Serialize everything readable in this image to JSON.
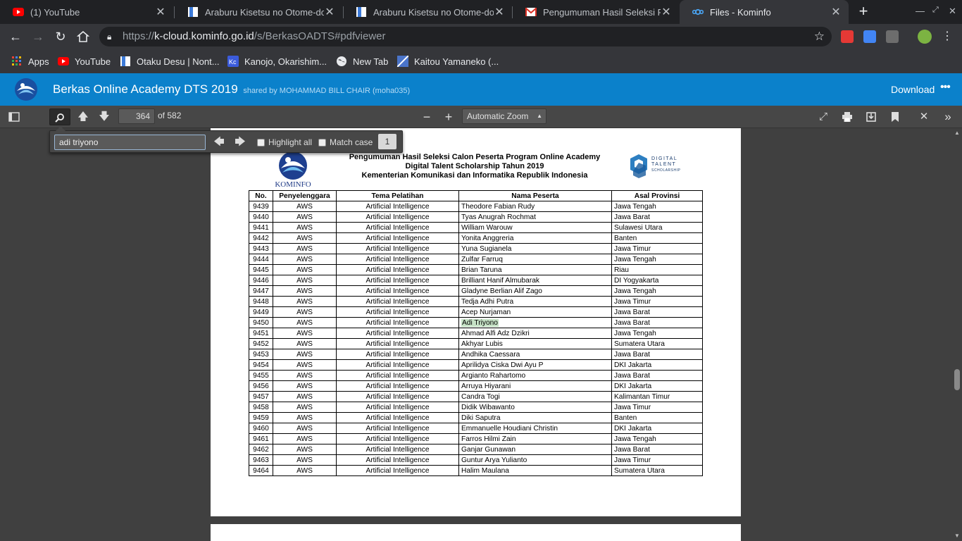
{
  "browser": {
    "tabs": [
      {
        "title": "(1) YouTube",
        "favicon": "youtube-icon",
        "active": false
      },
      {
        "title": "Araburu Kisetsu no Otome-dom",
        "favicon": "bookmark-doc-icon",
        "active": false
      },
      {
        "title": "Araburu Kisetsu no Otome-dom",
        "favicon": "bookmark-doc-icon",
        "active": false
      },
      {
        "title": "Pengumuman Hasil Seleksi Pro",
        "favicon": "gmail-icon",
        "active": false
      },
      {
        "title": "Files - Kominfo",
        "favicon": "nextcloud-icon",
        "active": true
      }
    ],
    "url": {
      "scheme": "https://",
      "host": "k-cloud.kominfo.go.id",
      "path": "/s/BerkasOADTS#pdfviewer"
    },
    "bookmarks": [
      {
        "label": "Apps",
        "icon": "apps-grid-icon"
      },
      {
        "label": "YouTube",
        "icon": "youtube-icon"
      },
      {
        "label": "Otaku Desu | Nont...",
        "icon": "bookmark-doc-icon"
      },
      {
        "label": "Kanojo, Okarishim...",
        "icon": "kc-icon"
      },
      {
        "label": "New Tab",
        "icon": "globe-icon"
      },
      {
        "label": "Kaitou Yamaneko (...",
        "icon": "bookmark-stripe-icon"
      }
    ]
  },
  "app": {
    "title": "Berkas Online Academy DTS 2019",
    "shared_by": "shared by MOHAMMAD BILL CHAIR (moha035)",
    "download_label": "Download",
    "brand_color": "#0b81cb"
  },
  "pdf_toolbar": {
    "page_number": "364",
    "page_of": "of 582",
    "zoom": "Automatic Zoom"
  },
  "findbar": {
    "query": "adi triyono",
    "highlight_all_label": "Highlight all",
    "match_case_label": "Match case",
    "match_count": "1"
  },
  "document": {
    "logo_text": "KOMINFO",
    "dts_logo_text": [
      "DIGITAL",
      "TALENT",
      "SCHOLARSHIP"
    ],
    "title_lines": [
      "Pengumuman Hasil Seleksi Calon Peserta Program Online Academy",
      "Digital Talent Scholarship Tahun 2019",
      "Kementerian Komunikasi dan Informatika Republik Indonesia"
    ],
    "columns": [
      "No.",
      "Penyelenggara",
      "Tema Pelatihan",
      "Nama Peserta",
      "Asal Provinsi"
    ],
    "highlight_name": "Adi Triyono",
    "rows": [
      [
        "9439",
        "AWS",
        "Artificial Intelligence",
        "Theodore Fabian Rudy",
        "Jawa Tengah"
      ],
      [
        "9440",
        "AWS",
        "Artificial Intelligence",
        "Tyas Anugrah Rochmat",
        "Jawa Barat"
      ],
      [
        "9441",
        "AWS",
        "Artificial Intelligence",
        "William Warouw",
        "Sulawesi Utara"
      ],
      [
        "9442",
        "AWS",
        "Artificial Intelligence",
        "Yonita Anggreria",
        "Banten"
      ],
      [
        "9443",
        "AWS",
        "Artificial Intelligence",
        "Yuna Sugianela",
        "Jawa Timur"
      ],
      [
        "9444",
        "AWS",
        "Artificial Intelligence",
        "Zulfar Farruq",
        "Jawa Tengah"
      ],
      [
        "9445",
        "AWS",
        "Artificial Intelligence",
        "Brian Taruna",
        "Riau"
      ],
      [
        "9446",
        "AWS",
        "Artificial Intelligence",
        "Brilliant Hanif Almubarak",
        "DI Yogyakarta"
      ],
      [
        "9447",
        "AWS",
        "Artificial Intelligence",
        "Gladyne Berlian Alif Zago",
        "Jawa Tengah"
      ],
      [
        "9448",
        "AWS",
        "Artificial Intelligence",
        "Tedja Adhi Putra",
        "Jawa Timur"
      ],
      [
        "9449",
        "AWS",
        "Artificial Intelligence",
        "Acep Nurjaman",
        "Jawa Barat"
      ],
      [
        "9450",
        "AWS",
        "Artificial Intelligence",
        "Adi Triyono",
        "Jawa Barat"
      ],
      [
        "9451",
        "AWS",
        "Artificial Intelligence",
        "Ahmad Alfi Adz Dzikri",
        "Jawa Tengah"
      ],
      [
        "9452",
        "AWS",
        "Artificial Intelligence",
        "Akhyar Lubis",
        "Sumatera Utara"
      ],
      [
        "9453",
        "AWS",
        "Artificial Intelligence",
        "Andhika Caessara",
        "Jawa Barat"
      ],
      [
        "9454",
        "AWS",
        "Artificial Intelligence",
        "Aprilidya Ciska Dwi Ayu P",
        "DKI Jakarta"
      ],
      [
        "9455",
        "AWS",
        "Artificial Intelligence",
        "Argianto Rahartomo",
        "Jawa Barat"
      ],
      [
        "9456",
        "AWS",
        "Artificial Intelligence",
        "Arruya Hiyarani",
        "DKI Jakarta"
      ],
      [
        "9457",
        "AWS",
        "Artificial Intelligence",
        "Candra Togi",
        "Kalimantan Timur"
      ],
      [
        "9458",
        "AWS",
        "Artificial Intelligence",
        "Didik Wibawanto",
        "Jawa Timur"
      ],
      [
        "9459",
        "AWS",
        "Artificial Intelligence",
        "Diki Saputra",
        "Banten"
      ],
      [
        "9460",
        "AWS",
        "Artificial Intelligence",
        "Emmanuelle Houdiani Christin",
        "DKI Jakarta"
      ],
      [
        "9461",
        "AWS",
        "Artificial Intelligence",
        "Farros Hilmi Zain",
        "Jawa Tengah"
      ],
      [
        "9462",
        "AWS",
        "Artificial Intelligence",
        "Ganjar Gunawan",
        "Jawa Barat"
      ],
      [
        "9463",
        "AWS",
        "Artificial Intelligence",
        "Guntur Arya Yulianto",
        "Jawa Timur"
      ],
      [
        "9464",
        "AWS",
        "Artificial Intelligence",
        "Halim Maulana",
        "Sumatera Utara"
      ]
    ]
  }
}
